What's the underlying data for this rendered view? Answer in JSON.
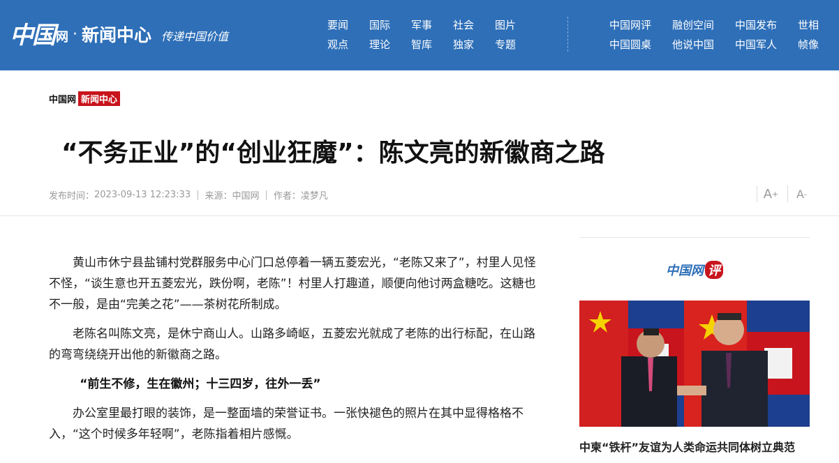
{
  "header": {
    "logo_main": "中国",
    "logo_wang": "网",
    "logo_dot": "·",
    "logo_section": "新闻中心",
    "logo_slogan": "传递中国价值",
    "nav_left": [
      "要闻",
      "国际",
      "军事",
      "社会",
      "图片",
      "观点",
      "理论",
      "智库",
      "独家",
      "专题"
    ],
    "nav_right": [
      "中国网评",
      "融创空间",
      "中国发布",
      "世相",
      "中国圆桌",
      "他说中国",
      "中国军人",
      "帧像"
    ]
  },
  "breadcrumb": {
    "site": "中国网",
    "section": "新闻中心"
  },
  "article": {
    "title": "“不务正业”的“创业狂魔”：陈文亮的新徽商之路",
    "meta": {
      "published_label": "发布时间：",
      "published": "2023-09-13 12:23:33",
      "source_label": "来源：",
      "source": "中国网",
      "author_label": "作者：",
      "author": "凌梦凡"
    },
    "font_larger": "A",
    "font_larger_sup": "+",
    "font_smaller": "A",
    "font_smaller_sup": "-",
    "paragraphs": [
      "黄山市休宁县盐铺村党群服务中心门口总停着一辆五菱宏光，“老陈又来了”，村里人见怪不怪，“谈生意也开五菱宏光，跌份啊，老陈”！村里人打趣道，顺便向他讨两盒糖吃。这糖也不一般，是由“完美之花”——茶树花所制成。",
      "老陈名叫陈文亮，是休宁商山人。山路多崎岖，五菱宏光就成了老陈的出行标配，在山路的弯弯绕绕开出他的新徽商之路。",
      "办公室里最打眼的装饰，是一整面墙的荣誉证书。一张快褪色的照片在其中显得格格不入，“这个时候多年轻啊”，老陈指着相片感慨。"
    ],
    "subheading": "“前生不修，生在徽州；十三四岁，往外一丢”"
  },
  "sidebar": {
    "logo_text": "中国网",
    "logo_ping": "评",
    "caption": "中柬“铁杆”友谊为人类命运共同体树立典范"
  },
  "colors": {
    "header_blue": "#2e6fb8",
    "accent_red": "#c8141c"
  }
}
